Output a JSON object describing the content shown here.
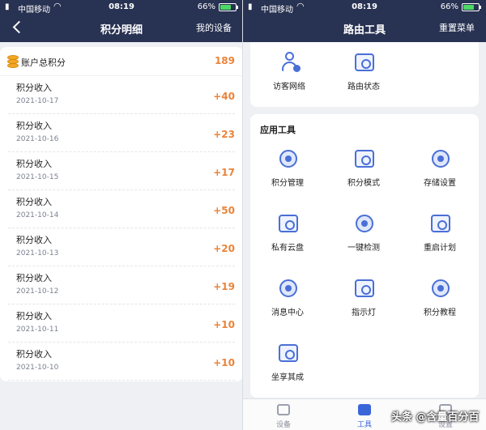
{
  "status_left": {
    "carrier": "中国移动",
    "time": "08:19",
    "battery": "66%"
  },
  "status_right": {
    "carrier": "中国移动",
    "time": "08:19",
    "battery": "66%"
  },
  "left_nav": {
    "title": "积分明细",
    "right_button": "我的设备"
  },
  "right_nav": {
    "title": "路由工具",
    "right_button": "重置菜单"
  },
  "points": {
    "total_label": "账户总积分",
    "total_value": "189",
    "records": [
      {
        "title": "积分收入",
        "date": "2021-10-17",
        "points": "+40"
      },
      {
        "title": "积分收入",
        "date": "2021-10-16",
        "points": "+23"
      },
      {
        "title": "积分收入",
        "date": "2021-10-15",
        "points": "+17"
      },
      {
        "title": "积分收入",
        "date": "2021-10-14",
        "points": "+50"
      },
      {
        "title": "积分收入",
        "date": "2021-10-13",
        "points": "+20"
      },
      {
        "title": "积分收入",
        "date": "2021-10-12",
        "points": "+19"
      },
      {
        "title": "积分收入",
        "date": "2021-10-11",
        "points": "+10"
      },
      {
        "title": "积分收入",
        "date": "2021-10-10",
        "points": "+10"
      }
    ]
  },
  "top_tools": [
    {
      "label": "访客网络",
      "icon": "guest-network-icon"
    },
    {
      "label": "路由状态",
      "icon": "router-status-icon"
    }
  ],
  "app_tools": {
    "heading": "应用工具",
    "items": [
      {
        "label": "积分管理",
        "icon": "points-management-icon"
      },
      {
        "label": "积分模式",
        "icon": "points-mode-icon"
      },
      {
        "label": "存储设置",
        "icon": "storage-settings-icon"
      },
      {
        "label": "私有云盘",
        "icon": "private-cloud-icon"
      },
      {
        "label": "一键检测",
        "icon": "one-click-check-icon"
      },
      {
        "label": "重启计划",
        "icon": "restart-schedule-icon"
      },
      {
        "label": "消息中心",
        "icon": "message-center-icon"
      },
      {
        "label": "指示灯",
        "icon": "indicator-light-icon"
      },
      {
        "label": "积分教程",
        "icon": "points-tutorial-icon"
      },
      {
        "label": "坐享其成",
        "icon": "rocket-icon"
      }
    ]
  },
  "tabbar": [
    {
      "label": "设备",
      "icon": "device-icon",
      "active": false
    },
    {
      "label": "工具",
      "icon": "toolbox-icon",
      "active": true
    },
    {
      "label": "设置",
      "icon": "settings-icon",
      "active": false
    }
  ],
  "watermark": "头条 @含量百分百",
  "colors": {
    "nav_bg": "#283252",
    "accent_orange": "#e9843a",
    "icon_blue": "#4a6fd6",
    "tab_active": "#3a66d8"
  }
}
